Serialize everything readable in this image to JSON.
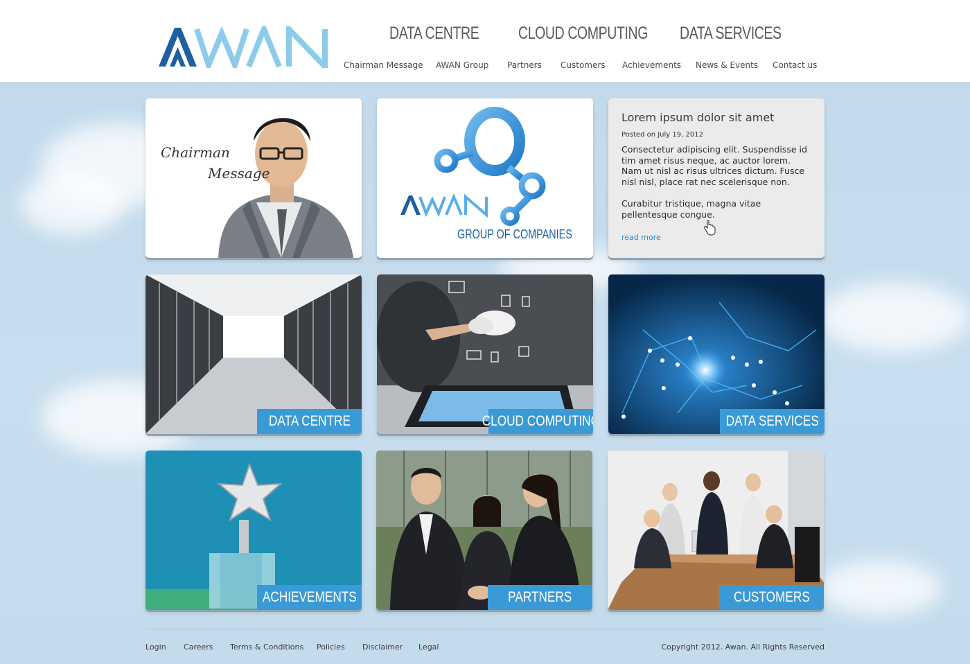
{
  "brand": {
    "logo_text": "AWAN",
    "accent": "#3a9ad6",
    "logo_dark": "#1d5fa0",
    "logo_light": "#8ccbea"
  },
  "primary_nav": [
    "DATA CENTRE",
    "CLOUD COMPUTING",
    "DATA SERVICES"
  ],
  "secondary_nav": [
    "Chairman Message",
    "AWAN Group",
    "Partners",
    "Customers",
    "Achievements",
    "News & Events",
    "Contact us"
  ],
  "chairman_tile": {
    "script_line1": "Chairman",
    "script_line2": "Message"
  },
  "group_tile": {
    "logo_text": "AWAN",
    "subtitle": "GROUP OF COMPANIES"
  },
  "news": {
    "title": "Lorem ipsum dolor sit amet",
    "date": "Posted on July 19, 2012",
    "para1": "Consectetur adipiscing elit. Suspendisse id tim amet risus neque, ac auctor lorem. Nam ut nisl ac risus ultrices dictum. Fusce nisl nisl, place rat nec scelerisque non.",
    "para2": "Curabitur tristique, magna vitae pellentesque congue.",
    "read_more": "read more"
  },
  "tiles": {
    "data_centre": "DATA CENTRE",
    "cloud_computing": "CLOUD COMPUTING",
    "data_services": "DATA SERVICES",
    "achievements": "ACHIEVEMENTS",
    "partners": "PARTNERS",
    "customers": "CUSTOMERS"
  },
  "footer": {
    "links": [
      "Login",
      "Careers",
      "Terms & Conditions",
      "Policies",
      "Disclaimer",
      "Legal"
    ],
    "copyright": "Copyright 2012.  Awan.  All Rights Reserved"
  }
}
